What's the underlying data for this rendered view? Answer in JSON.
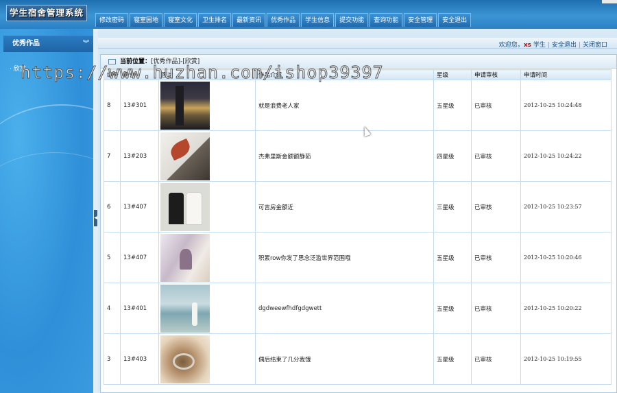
{
  "app": {
    "title": "学生宿舍管理系统"
  },
  "nav": [
    {
      "label": "修改密码"
    },
    {
      "label": "寝室园地"
    },
    {
      "label": "寝室文化"
    },
    {
      "label": "卫生排名"
    },
    {
      "label": "最新资讯"
    },
    {
      "label": "优秀作品"
    },
    {
      "label": "学生信息"
    },
    {
      "label": "提交功能"
    },
    {
      "label": "查询功能"
    },
    {
      "label": "安全管理"
    },
    {
      "label": "安全退出"
    }
  ],
  "sidebar": {
    "heading": "优秀作品",
    "items": [
      {
        "label": "· 欣赏"
      }
    ]
  },
  "userbar": {
    "welcome": "欢迎您，",
    "username": "xs",
    "role": "学生",
    "logout": "安全退出",
    "close": "关闭窗口"
  },
  "breadcrumb": {
    "label": "当前位置：",
    "path": "[优秀作品]-[欣赏]"
  },
  "table": {
    "headers": [
      "编号",
      "宿舍",
      "图片",
      "作品介绍",
      "星级",
      "申请审核",
      "申请时间"
    ],
    "rows": [
      {
        "id": "8",
        "dorm": "13#301",
        "img": "night-city-photo",
        "desc": "就是浪费老人家",
        "stars": "五星级",
        "status": "已审核",
        "time": "2012-10-25 10:24:48"
      },
      {
        "id": "7",
        "dorm": "13#203",
        "img": "red-leaf-book-photo",
        "desc": "杰弗里斯金额额静茹",
        "stars": "四星级",
        "status": "已审核",
        "time": "2012-10-25 10:24:22"
      },
      {
        "id": "6",
        "dorm": "13#407",
        "img": "wedding-bottles-photo",
        "desc": "可吉房金额近",
        "stars": "三星级",
        "status": "已审核",
        "time": "2012-10-25 10:23:57"
      },
      {
        "id": "5",
        "dorm": "13#407",
        "img": "girl-window-photo",
        "desc": "积累row你发了思念泛滥世界范围哦",
        "stars": "五星级",
        "status": "已审核",
        "time": "2012-10-25 10:20:46"
      },
      {
        "id": "4",
        "dorm": "13#401",
        "img": "beach-girl-photo",
        "desc": "dgdweewfhdfgdgwett",
        "stars": "五星级",
        "status": "已审核",
        "time": "2012-10-25 10:20:22"
      },
      {
        "id": "3",
        "dorm": "13#403",
        "img": "rings-photo",
        "desc": "偶后结束了几分我饿",
        "stars": "五星级",
        "status": "已审核",
        "time": "2012-10-25 10:19:55"
      }
    ]
  },
  "watermark": "https://www.huzhan.com/ishop39397"
}
